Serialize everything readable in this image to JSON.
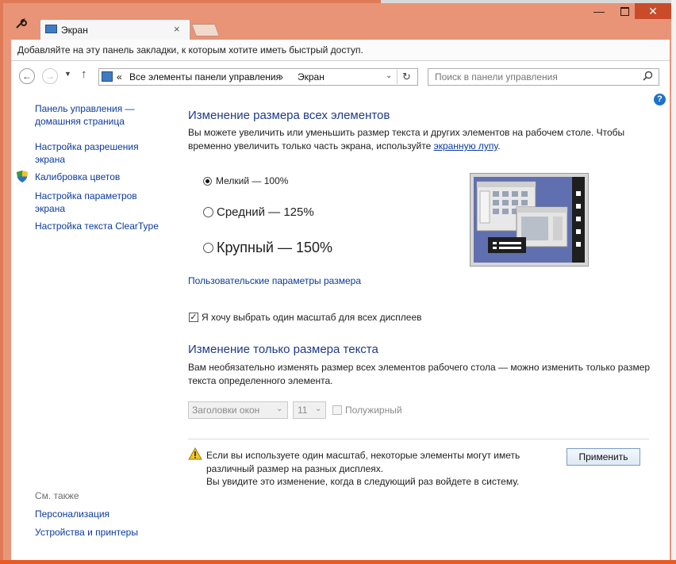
{
  "window": {
    "tab_title": "Экран",
    "tab_close": "×",
    "bookmarks_bar_text": "Добавляйте на эту панель закладки, к которым хотите иметь быстрый доступ."
  },
  "nav": {
    "breadcrumb_sep": "«",
    "breadcrumbs": [
      "Все элементы панели управления",
      "Экран"
    ],
    "breadcrumb_arrow": "›",
    "search_placeholder": "Поиск в панели управления"
  },
  "sidebar": {
    "items": [
      {
        "label": "Панель управления — домашняя страница"
      },
      {
        "label": "Настройка разрешения экрана"
      },
      {
        "label": "Калибровка цветов"
      },
      {
        "label": "Настройка параметров экрана"
      },
      {
        "label": "Настройка текста ClearType"
      }
    ],
    "see_also_label": "См. также",
    "see_also": [
      {
        "label": "Персонализация"
      },
      {
        "label": "Устройства и принтеры"
      }
    ]
  },
  "main": {
    "section1_title": "Изменение размера всех элементов",
    "section1_text_a": "Вы можете увеличить или уменьшить размер текста и других элементов на рабочем столе. Чтобы временно увеличить только часть экрана, используйте ",
    "section1_link": "экранную лупу",
    "section1_text_b": ".",
    "options": [
      {
        "label": "Мелкий — 100%",
        "selected": true
      },
      {
        "label": "Средний — 125%",
        "selected": false
      },
      {
        "label": "Крупный — 150%",
        "selected": false
      }
    ],
    "custom_size_link": "Пользовательские параметры размера",
    "one_scale_checkbox_label": "Я хочу выбрать один масштаб для всех дисплеев",
    "one_scale_checked": true,
    "section2_title": "Изменение только размера текста",
    "section2_text": "Вам необязательно изменять размер всех элементов рабочего стола — можно изменить только размер текста определенного элемента.",
    "element_select_value": "Заголовки окон",
    "font_size_select_value": "11",
    "bold_label": "Полужирный",
    "bold_checked": false,
    "warning_line1": "Если вы используете один масштаб, некоторые элементы могут иметь различный размер на разных дисплеях.",
    "warning_line2": "Вы увидите это изменение, когда в следующий раз войдете в систему.",
    "apply_label": "Применить"
  },
  "colors": {
    "accent_frame": "#e99477",
    "link": "#0a3aa0",
    "heading": "#1e3b8a"
  }
}
